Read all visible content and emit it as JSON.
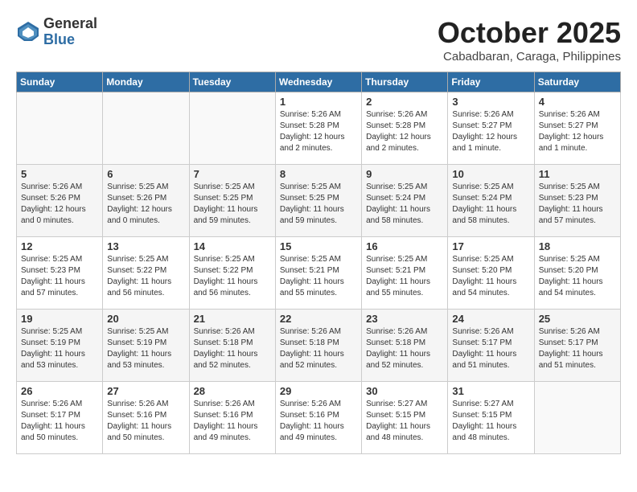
{
  "header": {
    "logo_general": "General",
    "logo_blue": "Blue",
    "month_title": "October 2025",
    "location": "Cabadbaran, Caraga, Philippines"
  },
  "weekdays": [
    "Sunday",
    "Monday",
    "Tuesday",
    "Wednesday",
    "Thursday",
    "Friday",
    "Saturday"
  ],
  "weeks": [
    [
      {
        "day": "",
        "info": ""
      },
      {
        "day": "",
        "info": ""
      },
      {
        "day": "",
        "info": ""
      },
      {
        "day": "1",
        "info": "Sunrise: 5:26 AM\nSunset: 5:28 PM\nDaylight: 12 hours\nand 2 minutes."
      },
      {
        "day": "2",
        "info": "Sunrise: 5:26 AM\nSunset: 5:28 PM\nDaylight: 12 hours\nand 2 minutes."
      },
      {
        "day": "3",
        "info": "Sunrise: 5:26 AM\nSunset: 5:27 PM\nDaylight: 12 hours\nand 1 minute."
      },
      {
        "day": "4",
        "info": "Sunrise: 5:26 AM\nSunset: 5:27 PM\nDaylight: 12 hours\nand 1 minute."
      }
    ],
    [
      {
        "day": "5",
        "info": "Sunrise: 5:26 AM\nSunset: 5:26 PM\nDaylight: 12 hours\nand 0 minutes."
      },
      {
        "day": "6",
        "info": "Sunrise: 5:25 AM\nSunset: 5:26 PM\nDaylight: 12 hours\nand 0 minutes."
      },
      {
        "day": "7",
        "info": "Sunrise: 5:25 AM\nSunset: 5:25 PM\nDaylight: 11 hours\nand 59 minutes."
      },
      {
        "day": "8",
        "info": "Sunrise: 5:25 AM\nSunset: 5:25 PM\nDaylight: 11 hours\nand 59 minutes."
      },
      {
        "day": "9",
        "info": "Sunrise: 5:25 AM\nSunset: 5:24 PM\nDaylight: 11 hours\nand 58 minutes."
      },
      {
        "day": "10",
        "info": "Sunrise: 5:25 AM\nSunset: 5:24 PM\nDaylight: 11 hours\nand 58 minutes."
      },
      {
        "day": "11",
        "info": "Sunrise: 5:25 AM\nSunset: 5:23 PM\nDaylight: 11 hours\nand 57 minutes."
      }
    ],
    [
      {
        "day": "12",
        "info": "Sunrise: 5:25 AM\nSunset: 5:23 PM\nDaylight: 11 hours\nand 57 minutes."
      },
      {
        "day": "13",
        "info": "Sunrise: 5:25 AM\nSunset: 5:22 PM\nDaylight: 11 hours\nand 56 minutes."
      },
      {
        "day": "14",
        "info": "Sunrise: 5:25 AM\nSunset: 5:22 PM\nDaylight: 11 hours\nand 56 minutes."
      },
      {
        "day": "15",
        "info": "Sunrise: 5:25 AM\nSunset: 5:21 PM\nDaylight: 11 hours\nand 55 minutes."
      },
      {
        "day": "16",
        "info": "Sunrise: 5:25 AM\nSunset: 5:21 PM\nDaylight: 11 hours\nand 55 minutes."
      },
      {
        "day": "17",
        "info": "Sunrise: 5:25 AM\nSunset: 5:20 PM\nDaylight: 11 hours\nand 54 minutes."
      },
      {
        "day": "18",
        "info": "Sunrise: 5:25 AM\nSunset: 5:20 PM\nDaylight: 11 hours\nand 54 minutes."
      }
    ],
    [
      {
        "day": "19",
        "info": "Sunrise: 5:25 AM\nSunset: 5:19 PM\nDaylight: 11 hours\nand 53 minutes."
      },
      {
        "day": "20",
        "info": "Sunrise: 5:25 AM\nSunset: 5:19 PM\nDaylight: 11 hours\nand 53 minutes."
      },
      {
        "day": "21",
        "info": "Sunrise: 5:26 AM\nSunset: 5:18 PM\nDaylight: 11 hours\nand 52 minutes."
      },
      {
        "day": "22",
        "info": "Sunrise: 5:26 AM\nSunset: 5:18 PM\nDaylight: 11 hours\nand 52 minutes."
      },
      {
        "day": "23",
        "info": "Sunrise: 5:26 AM\nSunset: 5:18 PM\nDaylight: 11 hours\nand 52 minutes."
      },
      {
        "day": "24",
        "info": "Sunrise: 5:26 AM\nSunset: 5:17 PM\nDaylight: 11 hours\nand 51 minutes."
      },
      {
        "day": "25",
        "info": "Sunrise: 5:26 AM\nSunset: 5:17 PM\nDaylight: 11 hours\nand 51 minutes."
      }
    ],
    [
      {
        "day": "26",
        "info": "Sunrise: 5:26 AM\nSunset: 5:17 PM\nDaylight: 11 hours\nand 50 minutes."
      },
      {
        "day": "27",
        "info": "Sunrise: 5:26 AM\nSunset: 5:16 PM\nDaylight: 11 hours\nand 50 minutes."
      },
      {
        "day": "28",
        "info": "Sunrise: 5:26 AM\nSunset: 5:16 PM\nDaylight: 11 hours\nand 49 minutes."
      },
      {
        "day": "29",
        "info": "Sunrise: 5:26 AM\nSunset: 5:16 PM\nDaylight: 11 hours\nand 49 minutes."
      },
      {
        "day": "30",
        "info": "Sunrise: 5:27 AM\nSunset: 5:15 PM\nDaylight: 11 hours\nand 48 minutes."
      },
      {
        "day": "31",
        "info": "Sunrise: 5:27 AM\nSunset: 5:15 PM\nDaylight: 11 hours\nand 48 minutes."
      },
      {
        "day": "",
        "info": ""
      }
    ]
  ]
}
